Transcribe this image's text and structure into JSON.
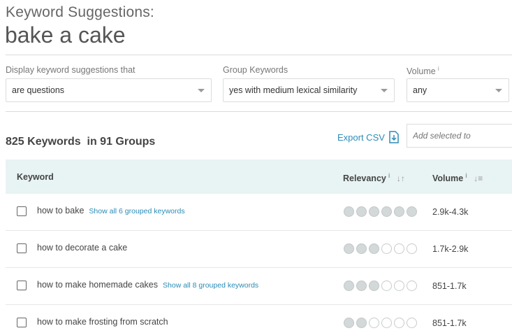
{
  "header": {
    "subtitle": "Keyword Suggestions:",
    "query": "bake a cake"
  },
  "filters": {
    "display": {
      "label": "Display keyword suggestions that",
      "value": "are questions"
    },
    "group": {
      "label": "Group Keywords",
      "value": "yes with medium lexical similarity"
    },
    "volume": {
      "label": "Volume",
      "info": "i",
      "value": "any"
    }
  },
  "summary": {
    "keywords_text": "825 Keywords",
    "groups_text": "in 91 Groups"
  },
  "actions": {
    "export_label": "Export CSV",
    "add_selected_placeholder": "Add selected to"
  },
  "table": {
    "headers": {
      "keyword": "Keyword",
      "relevancy": "Relevancy",
      "volume": "Volume",
      "info": "i"
    },
    "rows": [
      {
        "keyword": "how to bake",
        "group_link": "Show all 6 grouped keywords",
        "relevancy": 6,
        "volume": "2.9k-4.3k"
      },
      {
        "keyword": "how to decorate a cake",
        "group_link": "",
        "relevancy": 3,
        "volume": "1.7k-2.9k"
      },
      {
        "keyword": "how to make homemade cakes",
        "group_link": "Show all 8 grouped keywords",
        "relevancy": 3,
        "volume": "851-1.7k"
      },
      {
        "keyword": "how to make frosting from scratch",
        "group_link": "",
        "relevancy": 2,
        "volume": "851-1.7k"
      }
    ],
    "relevancy_max": 6
  },
  "colors": {
    "accent": "#2b8cb5",
    "header_bg": "#e8f3f3",
    "dot_filled": "#d3d8d9"
  }
}
